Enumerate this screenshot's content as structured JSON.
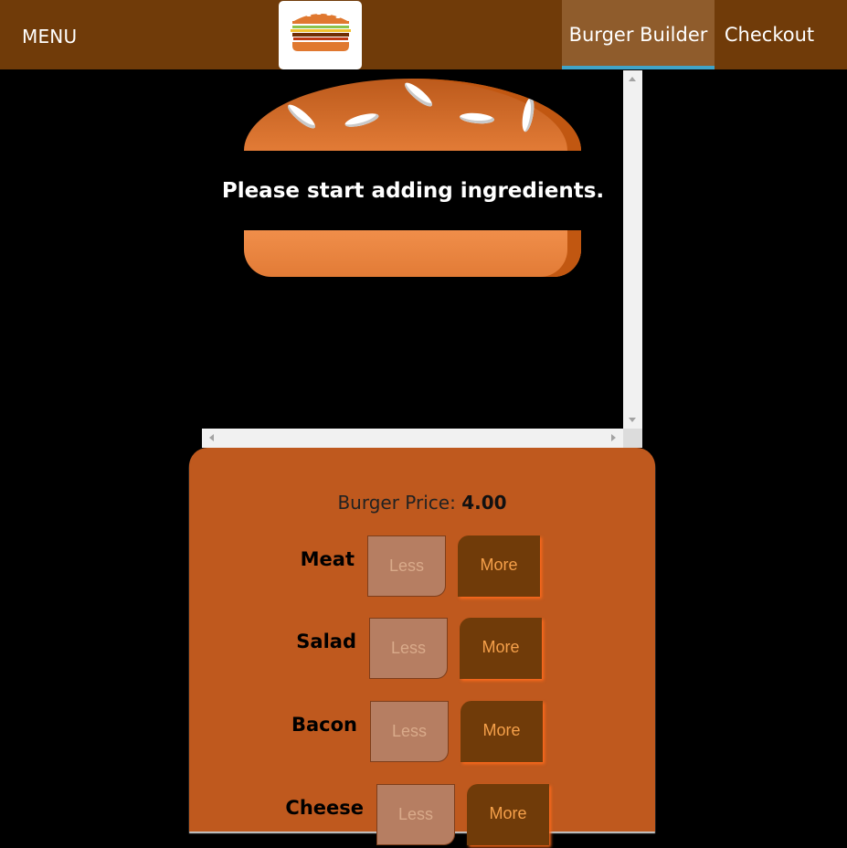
{
  "toolbar": {
    "menu_label": "MENU",
    "nav": [
      {
        "label": "Burger Builder",
        "active": true
      },
      {
        "label": "Checkout",
        "active": false
      }
    ]
  },
  "burger": {
    "empty_message": "Please start adding ingredients."
  },
  "controls": {
    "price_label": "Burger Price:",
    "price_value": "4.00",
    "ingredients": [
      {
        "label": "Meat",
        "less": "Less",
        "more": "More"
      },
      {
        "label": "Salad",
        "less": "Less",
        "more": "More"
      },
      {
        "label": "Bacon",
        "less": "Less",
        "more": "More"
      },
      {
        "label": "Cheese",
        "less": "Less",
        "more": "More"
      }
    ]
  },
  "colors": {
    "toolbar": "#703b09",
    "active_nav": "#8f5c2c",
    "active_underline": "#40a4c8",
    "controls_bg": "#bf591e"
  }
}
